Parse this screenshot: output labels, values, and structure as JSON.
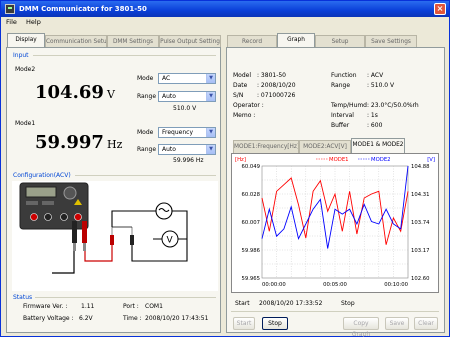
{
  "window": {
    "title": "DMM Communicator for 3801-50"
  },
  "menu": {
    "file": "File",
    "help": "Help"
  },
  "left_tabs": [
    "Display",
    "Communication Setup",
    "DMM Settings",
    "Pulse Output Setting"
  ],
  "right_tabs": [
    "Record",
    "Graph",
    "Setup",
    "Save Settings"
  ],
  "input": {
    "section": "Input",
    "mode2": {
      "label": "Mode2",
      "value": "104.69",
      "unit": "V",
      "mode_label": "Mode",
      "mode_value": "AC",
      "range_label": "Range",
      "range_value": "Auto",
      "range_note": "510.0 V"
    },
    "mode1": {
      "label": "Mode1",
      "value": "59.997",
      "unit": "Hz",
      "mode_label": "Mode",
      "mode_value": "Frequency",
      "range_label": "Range",
      "range_value": "Auto",
      "range_note": "59.996 Hz"
    }
  },
  "config": {
    "section": "Configuration(ACV)"
  },
  "status": {
    "section": "Status",
    "firmware_label": "Firmware Ver. :",
    "firmware_value": "1.11",
    "port_label": "Port :",
    "port_value": "COM1",
    "battery_label": "Battery Voltage :",
    "battery_value": "6.2V",
    "time_label": "Time :",
    "time_value": "2008/10/20 17:43:51"
  },
  "info": {
    "model_label": "Model",
    "model_value": ": 3801-50",
    "date_label": "Date",
    "date_value": ": 2008/10/20",
    "sn_label": "S/N",
    "sn_value": ": 071000726",
    "operator_label": "Operator :",
    "memo_label": "Memo :",
    "function_label": "Function",
    "function_value": ": ACV",
    "range_label": "Range",
    "range_value": ": 510.0 V",
    "temp_label": "Temp/Humd",
    "temp_value": ": 23.0°C/50.0%rh",
    "interval_label": "Interval",
    "interval_value": ": 1s",
    "buffer_label": "Buffer",
    "buffer_value": ": 600"
  },
  "graph_tabs": [
    "MODE1:Frequency[Hz]",
    "MODE2:ACV[V]",
    "MODE1 & MODE2"
  ],
  "graph": {
    "left_unit": "[Hz]",
    "right_unit": "[V]",
    "legend1": "MODE1",
    "legend2": "MODE2",
    "left_ticks": [
      "60.049",
      "60.028",
      "60.007",
      "59.986",
      "59.965"
    ],
    "right_ticks": [
      "104.88",
      "104.31",
      "103.74",
      "103.17",
      "102.60"
    ],
    "x_ticks": [
      "00:00:00",
      "00:05:00",
      "00:10:00"
    ]
  },
  "record": {
    "start_label": "Start",
    "start_value": "2008/10/20 17:33:52",
    "stop_label": "Stop",
    "stop_value": ""
  },
  "buttons": {
    "start": "Start",
    "stop": "Stop",
    "copy_graph": "Copy Graph",
    "save": "Save",
    "clear": "Clear"
  },
  "colors": {
    "mode1": "#ff0000",
    "mode2": "#0000ff",
    "section": "#0046d5"
  },
  "chart_data": {
    "type": "line",
    "x": [
      0,
      30,
      60,
      90,
      120,
      150,
      180,
      210,
      240,
      270,
      300,
      330,
      360,
      390,
      420,
      450,
      480,
      510,
      540,
      570,
      600
    ],
    "series": [
      {
        "name": "MODE1",
        "axis": "left",
        "values": [
          60.025,
          60.0,
          60.03,
          60.035,
          60.04,
          60.02,
          59.995,
          60.03,
          60.038,
          60.015,
          60.028,
          60.0,
          60.03,
          59.998,
          60.025,
          60.028,
          60.03,
          59.99,
          60.01,
          60.0,
          60.03
        ]
      },
      {
        "name": "MODE2",
        "axis": "right",
        "values": [
          103.4,
          104.0,
          103.45,
          103.6,
          104.05,
          103.4,
          103.7,
          104.0,
          104.2,
          103.2,
          104.0,
          103.9,
          104.0,
          103.7,
          104.1,
          103.75,
          103.7,
          104.0,
          103.7,
          103.6,
          104.88
        ]
      }
    ],
    "xlabel": "",
    "ylabel": "[Hz]",
    "y2label": "[V]",
    "ylim": [
      59.965,
      60.049
    ],
    "y2lim": [
      102.6,
      104.88
    ],
    "xlim": [
      0,
      600
    ]
  }
}
